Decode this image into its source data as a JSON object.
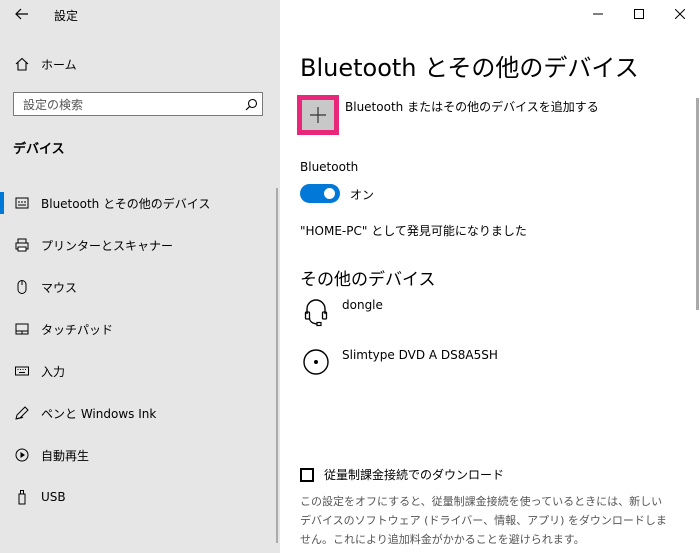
{
  "window": {
    "title": "設定"
  },
  "sidebar": {
    "home_label": "ホーム",
    "search_placeholder": "設定の検索",
    "section_header": "デバイス",
    "items": [
      {
        "label": "Bluetooth とその他のデバイス",
        "icon": "bluetooth-devices-icon",
        "active": true
      },
      {
        "label": "プリンターとスキャナー",
        "icon": "printer-icon",
        "active": false
      },
      {
        "label": "マウス",
        "icon": "mouse-icon",
        "active": false
      },
      {
        "label": "タッチパッド",
        "icon": "touchpad-icon",
        "active": false
      },
      {
        "label": "入力",
        "icon": "keyboard-icon",
        "active": false
      },
      {
        "label": "ペンと Windows Ink",
        "icon": "pen-icon",
        "active": false
      },
      {
        "label": "自動再生",
        "icon": "autoplay-icon",
        "active": false
      },
      {
        "label": "USB",
        "icon": "usb-icon",
        "active": false
      }
    ]
  },
  "main": {
    "title": "Bluetooth とその他のデバイス",
    "add_device_label": "Bluetooth またはその他のデバイスを追加する",
    "bluetooth_heading": "Bluetooth",
    "toggle_state": "オン",
    "discoverable_text": "\"HOME-PC\" として発見可能になりました",
    "other_devices_heading": "その他のデバイス",
    "devices": [
      {
        "name": "dongle",
        "icon": "headset-icon"
      },
      {
        "name": "Slimtype DVD A  DS8A5SH",
        "icon": "disc-drive-icon"
      }
    ],
    "metered_checkbox_label": "従量制課金接続でのダウンロード",
    "metered_description": "この設定をオフにすると、従量制課金接続を使っているときには、新しいデバイスのソフトウェア (ドライバー、情報、アプリ) をダウンロードしません。これにより追加料金がかかることを避けられます。"
  },
  "colors": {
    "accent": "#0078d7",
    "highlight": "#e9277a",
    "sidebar_bg": "#e6e6e6"
  }
}
